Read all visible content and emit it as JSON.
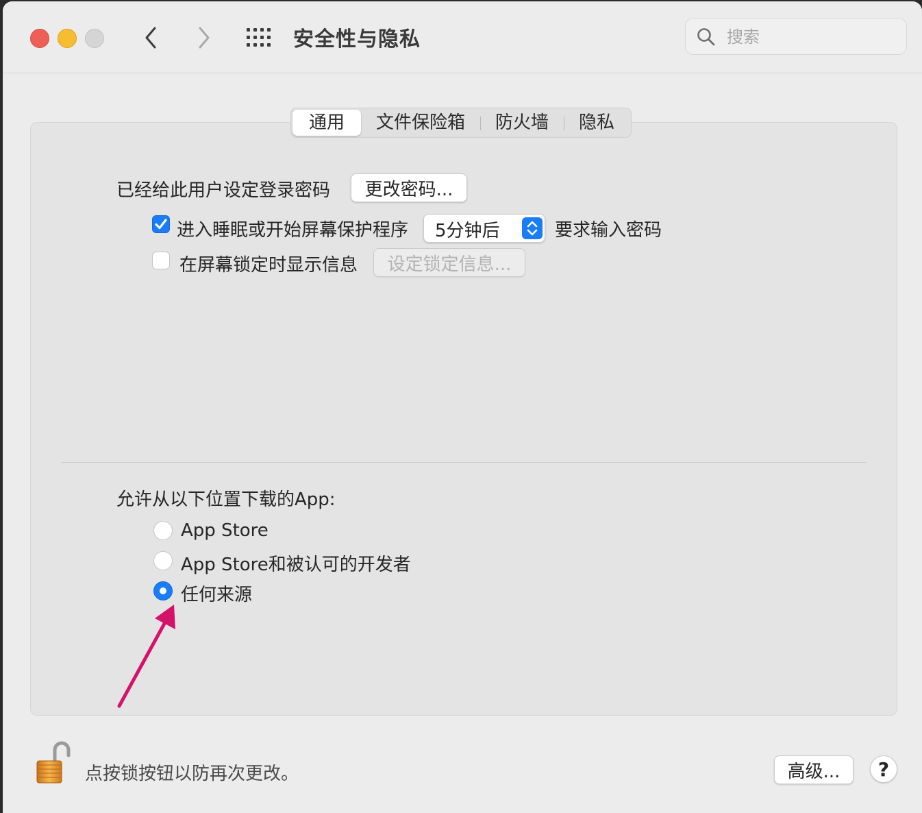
{
  "window": {
    "title": "安全性与隐私",
    "search_placeholder": "搜索"
  },
  "icons": {
    "back": "chevron-left-icon",
    "forward": "chevron-right-icon",
    "grid": "grid-icon",
    "search": "magnifier-icon",
    "checkbox_checked": "checkmark-icon",
    "popup": "up-down-chevron-icon",
    "lock": "unlocked-padlock-icon",
    "annotation": "arrow-icon"
  },
  "tabs": [
    "通用",
    "文件保险箱",
    "防火墙",
    "隐私"
  ],
  "general": {
    "password_label": "已经给此用户设定登录密码",
    "change_password_button": "更改密码...",
    "require_password": {
      "checked": true,
      "label": "进入睡眠或开始屏幕保护程序",
      "delay_value": "5分钟后",
      "suffix": "要求输入密码"
    },
    "lock_message": {
      "checked": false,
      "label": "在屏幕锁定时显示信息",
      "button": "设定锁定信息..."
    }
  },
  "downloads": {
    "heading": "允许从以下位置下载的App:",
    "options": [
      {
        "label": "App Store",
        "selected": false
      },
      {
        "label": "App Store和被认可的开发者",
        "selected": false
      },
      {
        "label": "任何来源",
        "selected": true
      }
    ]
  },
  "footer": {
    "lock_text": "点按锁按钮以防再次更改。",
    "advanced_button": "高级...",
    "help_button": "?"
  },
  "colors": {
    "accent": "#1a7df7",
    "annotation_arrow": "#d4126b",
    "close": "#ed5f57",
    "minimize": "#f5bd2f",
    "zoom": "#d5d5d5"
  }
}
